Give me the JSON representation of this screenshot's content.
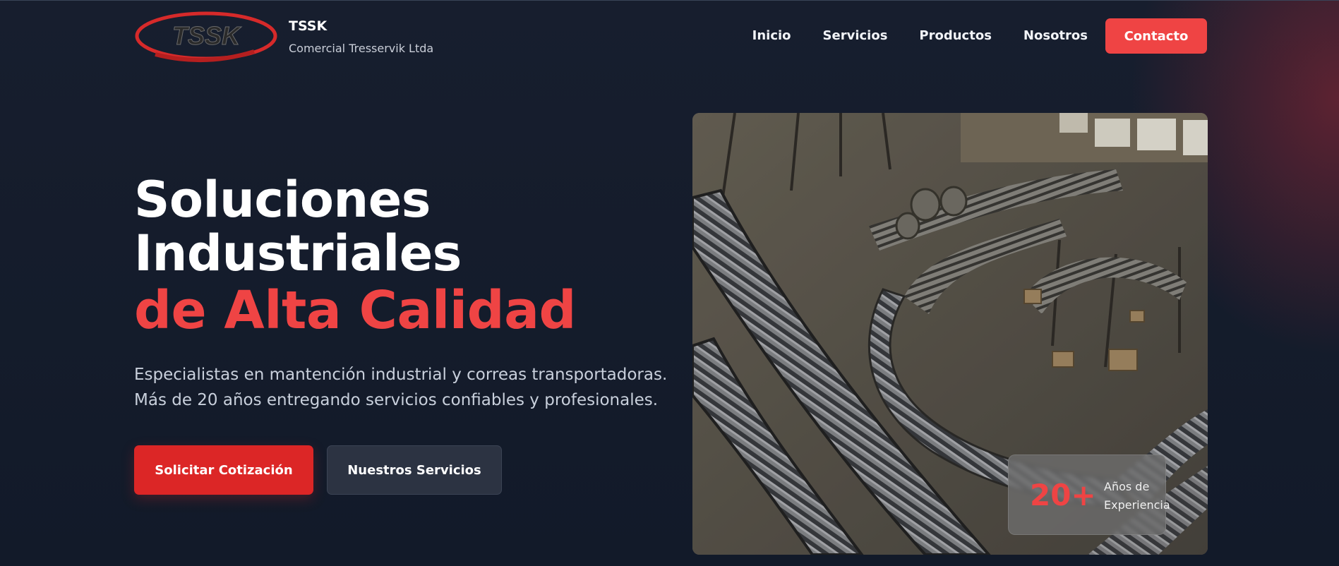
{
  "brand": {
    "logo_text": "TSSK",
    "name": "TSSK",
    "subtitle": "Comercial Tresservik Ltda"
  },
  "nav": {
    "items": [
      {
        "label": "Inicio"
      },
      {
        "label": "Servicios"
      },
      {
        "label": "Productos"
      },
      {
        "label": "Nosotros"
      }
    ],
    "cta_label": "Contacto"
  },
  "hero": {
    "title_line1": "Soluciones",
    "title_line2": "Industriales",
    "title_accent": "de Alta Calidad",
    "description_line1": "Especialistas en mantención industrial y correas transportadoras.",
    "description_line2": "Más de 20 años entregando servicios confiables y profesionales.",
    "primary_button": "Solicitar Cotización",
    "secondary_button": "Nuestros Servicios"
  },
  "stat": {
    "number": "20+",
    "label": "Años de Experiencia"
  },
  "image": {
    "icon": "conveyor-factory-photo"
  },
  "colors": {
    "accent": "#ef4444",
    "background": "#141b2b",
    "secondary_button": "#2c3342"
  }
}
